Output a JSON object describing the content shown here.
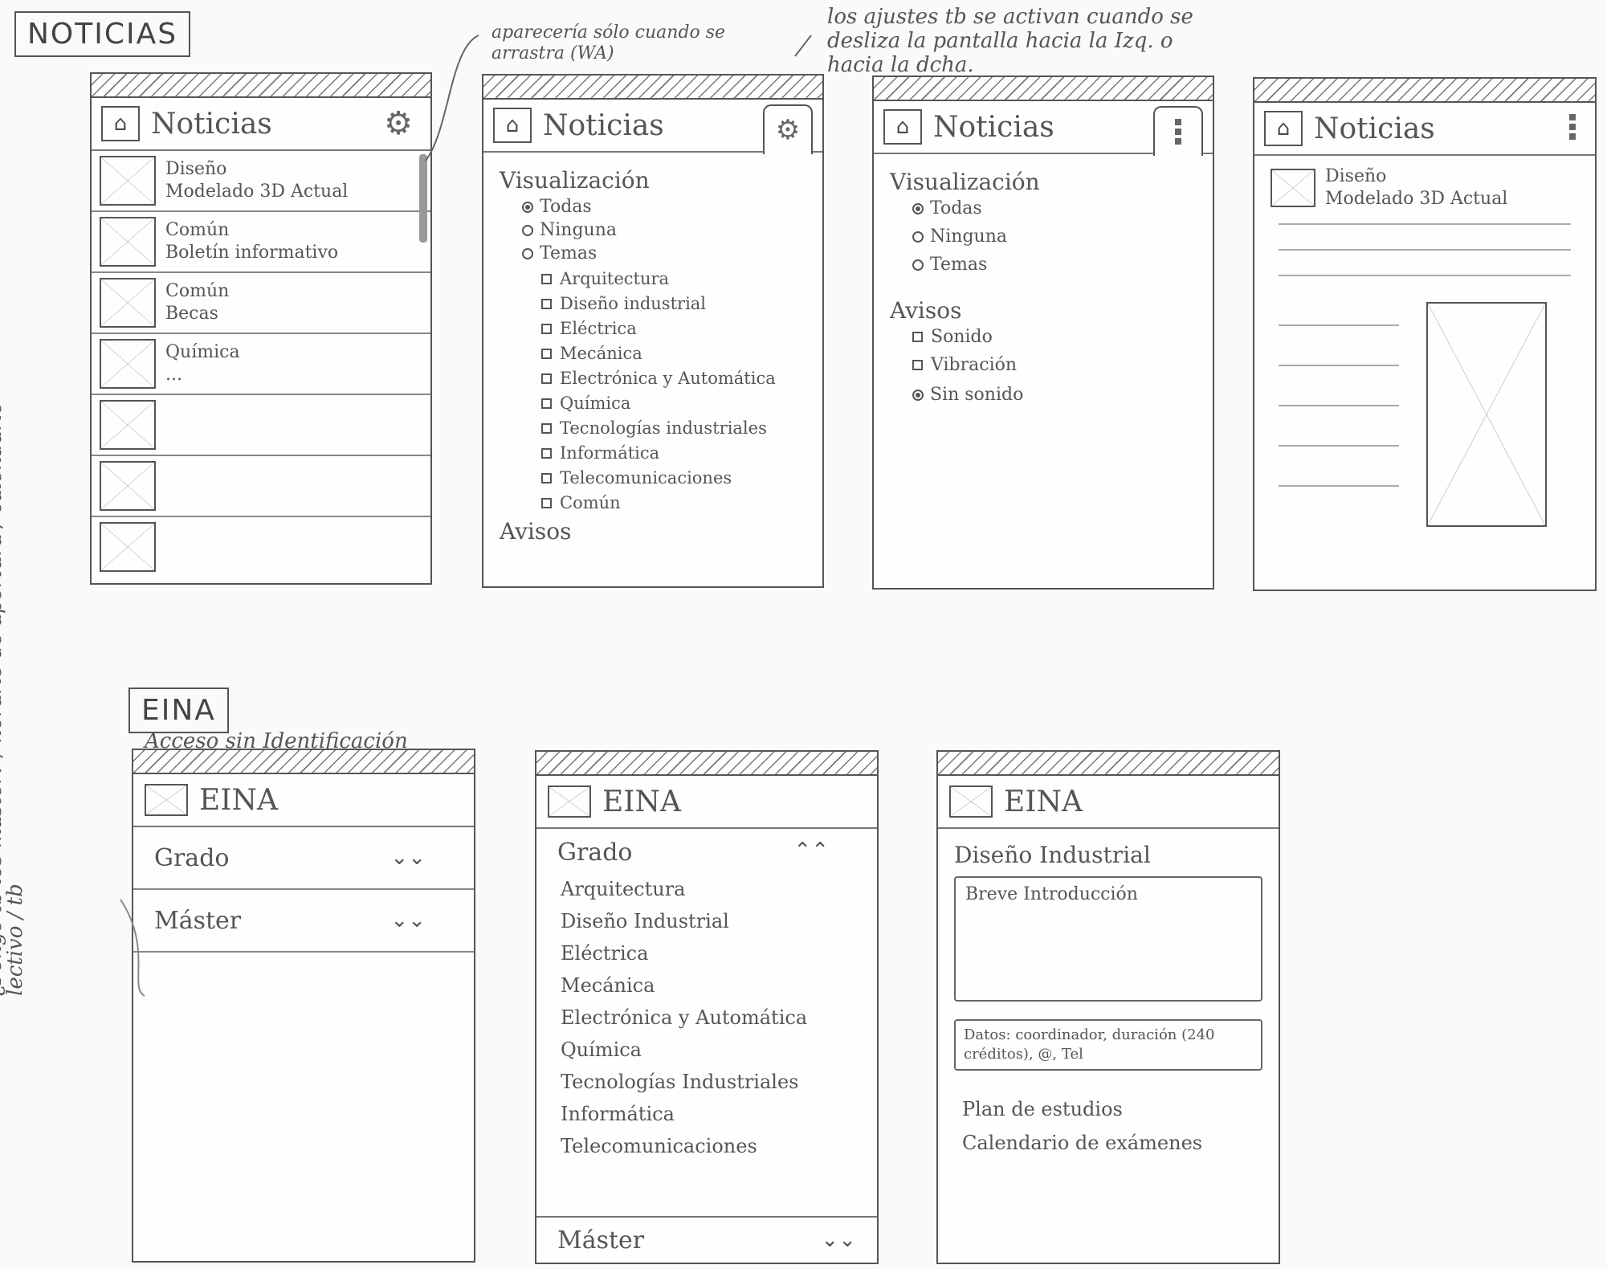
{
  "labels": {
    "noticias": "NOTICIAS",
    "eina": "EINA",
    "acceso": "Acceso sin Identificación"
  },
  "notes": {
    "drag": "aparecería sólo cuando se arrastra (WA)",
    "swipe": "los ajustes tb se activan cuando se desliza la pantalla hacia la Izq. o hacia la dcha.",
    "side": "¿Pongo tb los máster? / horario de apertura / calendario lectivo / tb"
  },
  "colors": {
    "ink": "#555555",
    "paper": "#fbfaf8"
  },
  "phone1": {
    "title": "Noticias",
    "items": [
      {
        "line1": "Diseño",
        "line2": "Modelado 3D Actual"
      },
      {
        "line1": "Común",
        "line2": "Boletín informativo"
      },
      {
        "line1": "Común",
        "line2": "Becas"
      },
      {
        "line1": "Química",
        "line2": "..."
      },
      {
        "line1": "",
        "line2": ""
      },
      {
        "line1": "",
        "line2": ""
      },
      {
        "line1": "",
        "line2": ""
      }
    ]
  },
  "phone2": {
    "title": "Noticias",
    "visualizacion": "Visualización",
    "todas": "Todas",
    "ninguna": "Ninguna",
    "temas": "Temas",
    "topics": [
      "Arquitectura",
      "Diseño industrial",
      "Eléctrica",
      "Mecánica",
      "Electrónica y Automática",
      "Química",
      "Tecnologías industriales",
      "Informática",
      "Telecomunicaciones",
      "Común"
    ],
    "avisos": "Avisos"
  },
  "phone3": {
    "title": "Noticias",
    "visualizacion": "Visualización",
    "todas": "Todas",
    "ninguna": "Ninguna",
    "temas": "Temas",
    "avisos": "Avisos",
    "sonido": "Sonido",
    "vibracion": "Vibración",
    "sin_sonido": "Sin sonido"
  },
  "phone4": {
    "title": "Noticias",
    "line1": "Diseño",
    "line2": "Modelado 3D Actual"
  },
  "phone5": {
    "title": "EINA",
    "grado": "Grado",
    "master": "Máster"
  },
  "phone6": {
    "title": "EINA",
    "grado": "Grado",
    "degrees": [
      "Arquitectura",
      "Diseño Industrial",
      "Eléctrica",
      "Mecánica",
      "Electrónica y Automática",
      "Química",
      "Tecnologías Industriales",
      "Informática",
      "Telecomunicaciones"
    ],
    "master": "Máster"
  },
  "phone7": {
    "title": "EINA",
    "heading": "Diseño Industrial",
    "intro": "Breve Introducción",
    "datos": "Datos: coordinador, duración (240 créditos), @, Tel",
    "plan": "Plan de estudios",
    "calendario": "Calendario de exámenes"
  }
}
